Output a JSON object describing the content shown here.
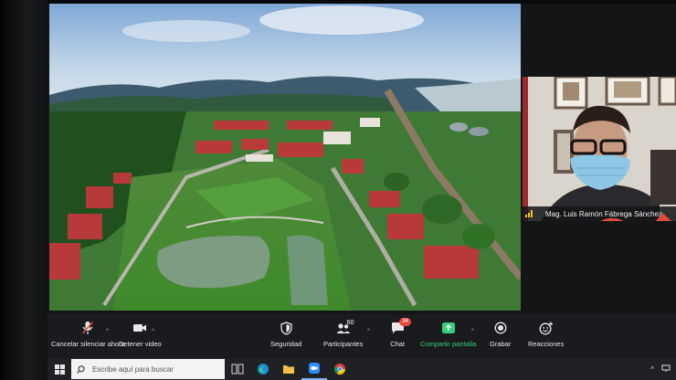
{
  "side_participant": {
    "name": "Mag. Luis Ramón Fábrega Sánchez"
  },
  "toolbar": {
    "mute_label": "Cancelar silenciar ahora",
    "video_label": "Detener video",
    "security_label": "Seguridad",
    "participants_label": "Participantes",
    "participants_count": "60",
    "chat_label": "Chat",
    "chat_badge": "34",
    "share_label": "Compartir pantalla",
    "record_label": "Grabar",
    "reactions_label": "Reacciones"
  },
  "taskbar": {
    "search_placeholder": "Escribe aquí para buscar"
  },
  "colors": {
    "toolbar_bg": "#1a1b1e",
    "share_green": "#33d17a",
    "badge_red": "#e8493b",
    "signal_yellow": "#f2c21a"
  }
}
